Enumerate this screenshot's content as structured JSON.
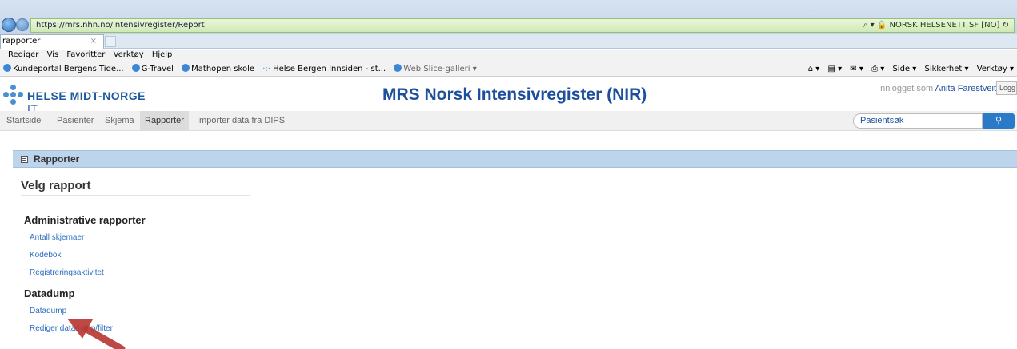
{
  "browser": {
    "url": "https://mrs.nhn.no/intensivregister/Report",
    "security_label": "NORSK HELSENETT SF [NO]",
    "tab_title": "rapporter",
    "tab_close": "×",
    "menu": [
      "Rediger",
      "Vis",
      "Favoritter",
      "Verktøy",
      "Hjelp"
    ],
    "favorites": [
      "Kundeportal Bergens Tide...",
      "G-Travel",
      "Mathopen skole",
      "Helse Bergen Innsiden - st...",
      "Web Slice-galleri ▾"
    ],
    "command_bar": [
      "Side ▾",
      "Sikkerhet ▾",
      "Verktøy ▾"
    ]
  },
  "header": {
    "logo_bold": "HELSE MIDT-NORGE",
    "logo_light": "IT",
    "app_title": "MRS Norsk Intensivregister (NIR)",
    "login_prefix": "Innlogget som",
    "user_name": "Anita Farestveit",
    "logout_label": "Logg"
  },
  "nav": {
    "items": [
      "Startside",
      "Pasienter",
      "Skjema",
      "Rapporter",
      "Importer data fra DIPS"
    ],
    "active": "Rapporter",
    "search_placeholder": "Pasientsøk",
    "search_icon": "search-icon"
  },
  "panel": {
    "title": "Rapporter",
    "heading": "Velg rapport",
    "sections": [
      {
        "title": "Administrative rapporter",
        "links": [
          "Antall skjemaer",
          "Kodebok",
          "Registreringsaktivitet"
        ]
      },
      {
        "title": "Datadump",
        "links": [
          "Datadump",
          "Rediger datadump/filter"
        ]
      }
    ]
  },
  "colors": {
    "accent": "#1e4f9c",
    "panel_header": "#bcd4ec",
    "link": "#2a6fbe",
    "annotation_arrow": "#b83a34"
  }
}
